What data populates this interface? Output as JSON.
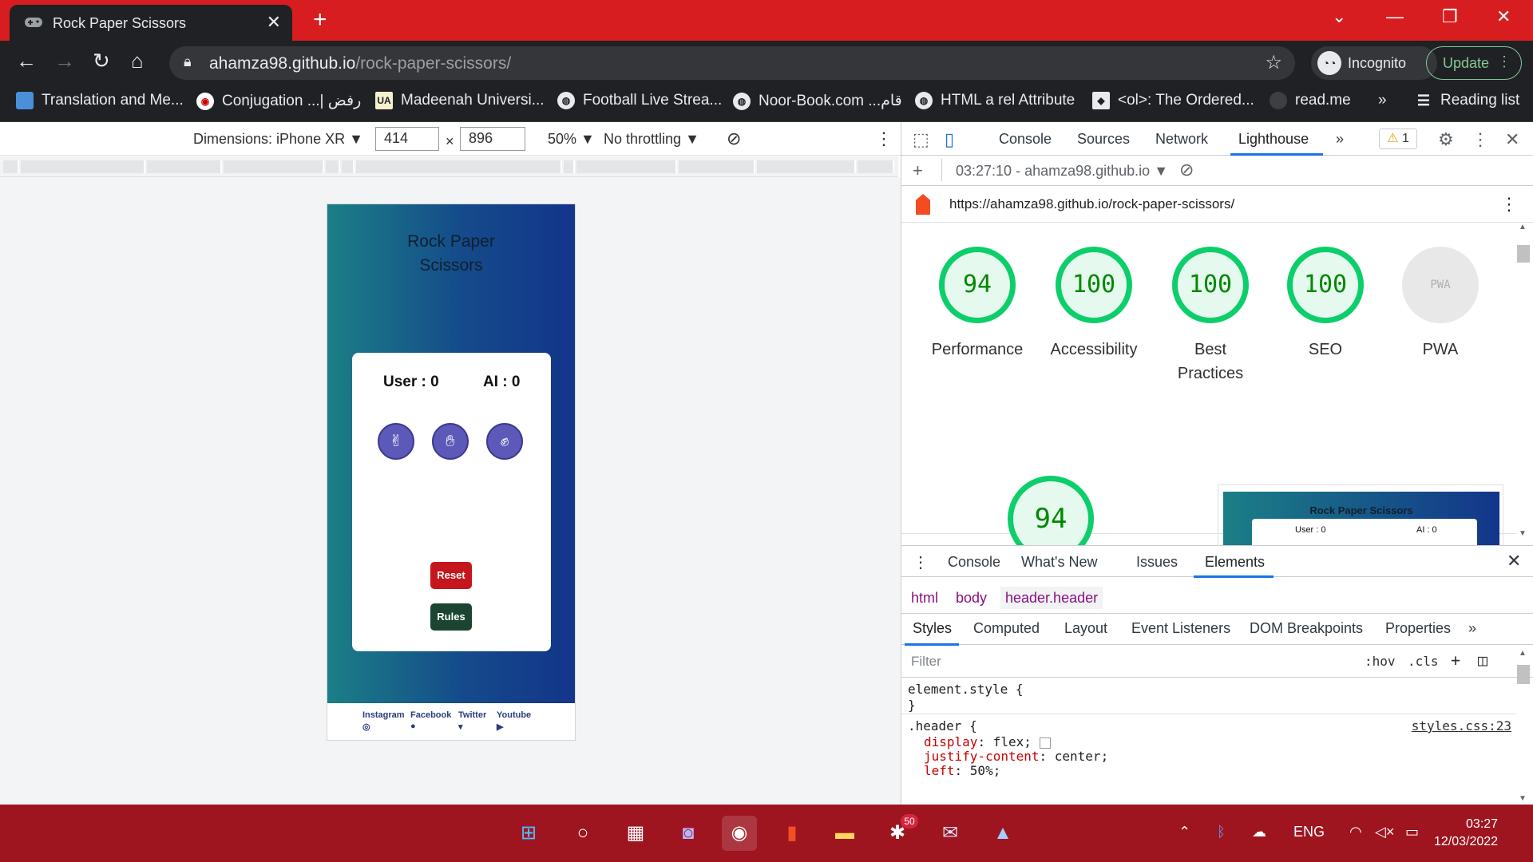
{
  "browser": {
    "tab_title": "Rock Paper Scissors",
    "url_host": "ahamza98.github.io",
    "url_path": "/rock-paper-scissors/",
    "incognito_label": "Incognito",
    "update_label": "Update"
  },
  "bookmarks": [
    {
      "label": "Translation and Me..."
    },
    {
      "label": "Conjugation ...| رفض"
    },
    {
      "label": "Madeenah Universi..."
    },
    {
      "label": "Football Live Strea..."
    },
    {
      "label": "Noor-Book.com ...قام"
    },
    {
      "label": "HTML a rel Attribute"
    },
    {
      "label": "<ol>: The Ordered..."
    },
    {
      "label": "read.me"
    },
    {
      "label": "»"
    },
    {
      "label": "Reading list"
    }
  ],
  "device_toolbar": {
    "dimensions_label": "Dimensions: iPhone XR",
    "width": "414",
    "height": "896",
    "zoom": "50%",
    "throttling": "No throttling"
  },
  "app": {
    "title_line1": "Rock Paper",
    "title_line2": "Scissors",
    "user_score": "User : 0",
    "ai_score": "AI : 0",
    "reset_label": "Reset",
    "rules_label": "Rules",
    "social": [
      "Instagram",
      "Facebook",
      "Twitter",
      "Youtube"
    ]
  },
  "devtools": {
    "tabs": [
      "Console",
      "Sources",
      "Network",
      "Lighthouse",
      "»"
    ],
    "active_tab": "Lighthouse",
    "warning_count": "1",
    "report_label": "03:27:10 - ahamza98.github.io",
    "report_url": "https://ahamza98.github.io/rock-paper-scissors/",
    "scores": [
      {
        "label": "Performance",
        "value": "94"
      },
      {
        "label": "Accessibility",
        "value": "100"
      },
      {
        "label": "Best Practices",
        "value": "100"
      },
      {
        "label": "SEO",
        "value": "100"
      },
      {
        "label": "PWA",
        "value": "PWA"
      }
    ],
    "big_score": "94",
    "thumb_title": "Rock Paper Scissors",
    "thumb_user": "User : 0",
    "thumb_ai": "AI : 0",
    "drawer_tabs": [
      "Console",
      "What's New",
      "Issues",
      "Elements"
    ],
    "breadcrumb": [
      "html",
      "body",
      "header.header"
    ],
    "subtabs": [
      "Styles",
      "Computed",
      "Layout",
      "Event Listeners",
      "DOM Breakpoints",
      "Properties",
      "»"
    ],
    "filter_placeholder": "Filter",
    "filter_tools": [
      ":hov",
      ".cls"
    ],
    "styles_lines": {
      "l1": "element.style {",
      "l2": "}",
      "l3": ".header {",
      "p1": "display",
      "v1": ": flex;",
      "p2": "justify-content",
      "v2": ": center;",
      "p3": "left",
      "v3": ": 50%;",
      "source": "styles.css:23"
    }
  },
  "taskbar": {
    "lang": "ENG",
    "time": "03:27",
    "date": "12/03/2022",
    "notif_badge": "50"
  },
  "colors": {
    "titlebar": "#d71d20",
    "taskbar": "#9e1520",
    "score_green": "#0cce6b",
    "reset_red": "#c4161c",
    "rules_green": "#1b4530",
    "choice_purple": "#5d59b8"
  }
}
